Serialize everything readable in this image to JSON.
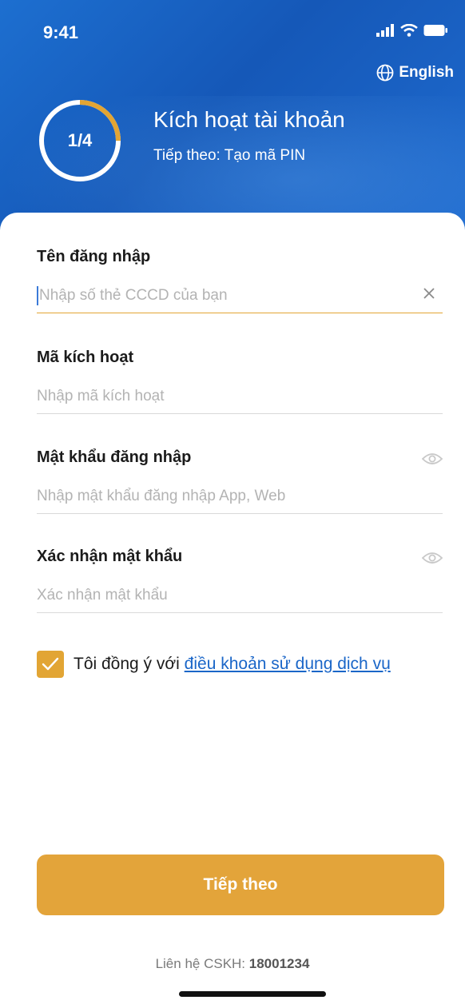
{
  "status_bar": {
    "time": "9:41"
  },
  "header": {
    "language_label": "English",
    "progress": {
      "step_text": "1/4",
      "fraction": 0.25
    },
    "title": "Kích hoạt tài khoản",
    "subtitle": "Tiếp theo: Tạo mã PIN"
  },
  "form": {
    "username": {
      "label": "Tên đăng nhập",
      "placeholder": "Nhập số thẻ CCCD của bạn",
      "value": ""
    },
    "activation_code": {
      "label": "Mã kích hoạt",
      "placeholder": "Nhập mã kích hoạt",
      "value": ""
    },
    "password": {
      "label": "Mật khẩu đăng nhập",
      "placeholder": "Nhập mật khẩu đăng nhập App, Web",
      "value": ""
    },
    "confirm_password": {
      "label": "Xác nhận mật khẩu",
      "placeholder": "Xác nhận mật khẩu",
      "value": ""
    }
  },
  "agreement": {
    "checked": true,
    "text": "Tôi đồng ý với ",
    "link_text": "điều khoản sử dụng dịch vụ"
  },
  "submit_label": "Tiếp theo",
  "contact": {
    "label": "Liên hệ CSKH: ",
    "phone": "18001234"
  },
  "colors": {
    "primary_blue": "#1d6fd0",
    "accent_orange": "#e3a43a",
    "link_blue": "#1a66c8"
  }
}
